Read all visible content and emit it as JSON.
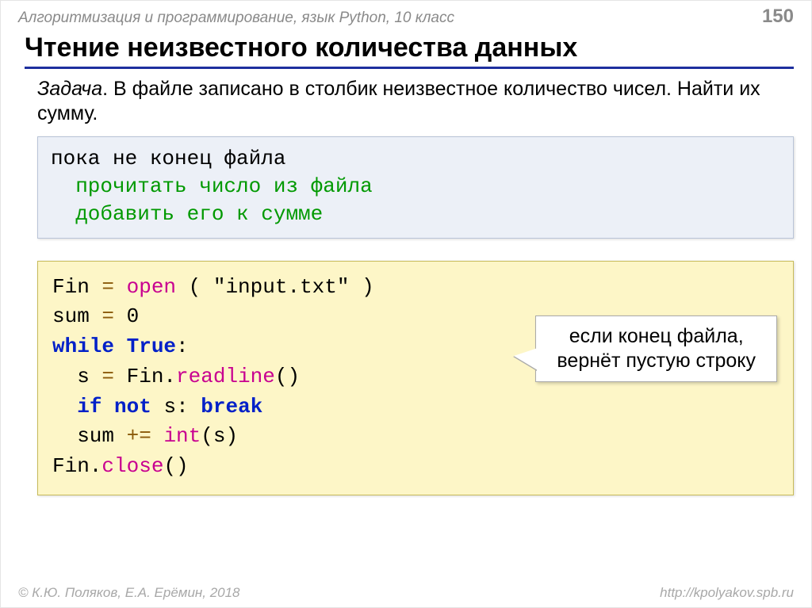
{
  "header": {
    "breadcrumb": "Алгоритмизация и программирование, язык Python, 10 класс",
    "page_number": "150"
  },
  "title": "Чтение неизвестного количества данных",
  "task": {
    "label": "Задача",
    "text": ". В файле записано в столбик неизвестное количество чисел. Найти их сумму."
  },
  "pseudo": {
    "line1": "пока не конец файла",
    "line2": "  прочитать число из файла",
    "line3": "  добавить его к сумме"
  },
  "code": {
    "l1_a": "Fin",
    "l1_eq": " = ",
    "l1_open": "open",
    "l1_b": " ( \"input.txt\" )",
    "l2_a": "sum",
    "l2_eq": " = ",
    "l2_b": "0",
    "l3_a": "while",
    "l3_sp": " ",
    "l3_true": "True",
    "l3_colon": ":",
    "l4_ind": "  s",
    "l4_eq": " = ",
    "l4_fin": "Fin.",
    "l4_read": "readline",
    "l4_par": "()",
    "l5_ind": "  ",
    "l5_if": "if",
    "l5_sp1": " ",
    "l5_not": "not",
    "l5_sp2": " s: ",
    "l5_break": "break",
    "l6_ind": "  sum",
    "l6_eq": " += ",
    "l6_int": "int",
    "l6_par": "(s)",
    "l7_a": "Fin.",
    "l7_close": "close",
    "l7_par": "()"
  },
  "callout": {
    "line1": "если конец файла,",
    "line2": "вернёт пустую строку"
  },
  "footer": {
    "left": "© К.Ю. Поляков, Е.А. Ерёмин, 2018",
    "right": "http://kpolyakov.spb.ru"
  }
}
